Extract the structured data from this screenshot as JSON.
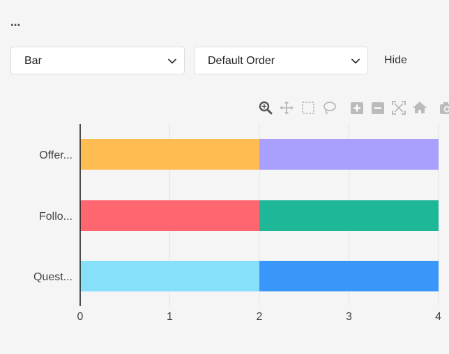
{
  "header": {
    "menu_label": "..."
  },
  "controls": {
    "chart_type": "Bar",
    "sort_order": "Default Order",
    "hide_label": "Hide"
  },
  "toolbar": {
    "icons": [
      "zoom-icon",
      "pan-icon",
      "box-select-icon",
      "lasso-select-icon",
      "zoom-in-icon",
      "zoom-out-icon",
      "autoscale-icon",
      "reset-axes-icon",
      "camera-icon"
    ]
  },
  "chart_data": {
    "type": "bar",
    "orientation": "horizontal",
    "stacked": true,
    "categories": [
      "Offer...",
      "Follo...",
      "Quest..."
    ],
    "segments": [
      {
        "category": "Offer...",
        "values": [
          2,
          2
        ],
        "colors": [
          "#FEBC52",
          "#A99FFE"
        ]
      },
      {
        "category": "Follo...",
        "values": [
          2,
          2
        ],
        "colors": [
          "#FE6670",
          "#1EB798"
        ]
      },
      {
        "category": "Quest...",
        "values": [
          2,
          2
        ],
        "colors": [
          "#86E0FA",
          "#3A97F9"
        ]
      }
    ],
    "xlim": [
      0,
      4
    ],
    "xticks": [
      "0",
      "1",
      "2",
      "3",
      "4"
    ],
    "grid": true,
    "title": "",
    "xlabel": "",
    "ylabel": ""
  }
}
